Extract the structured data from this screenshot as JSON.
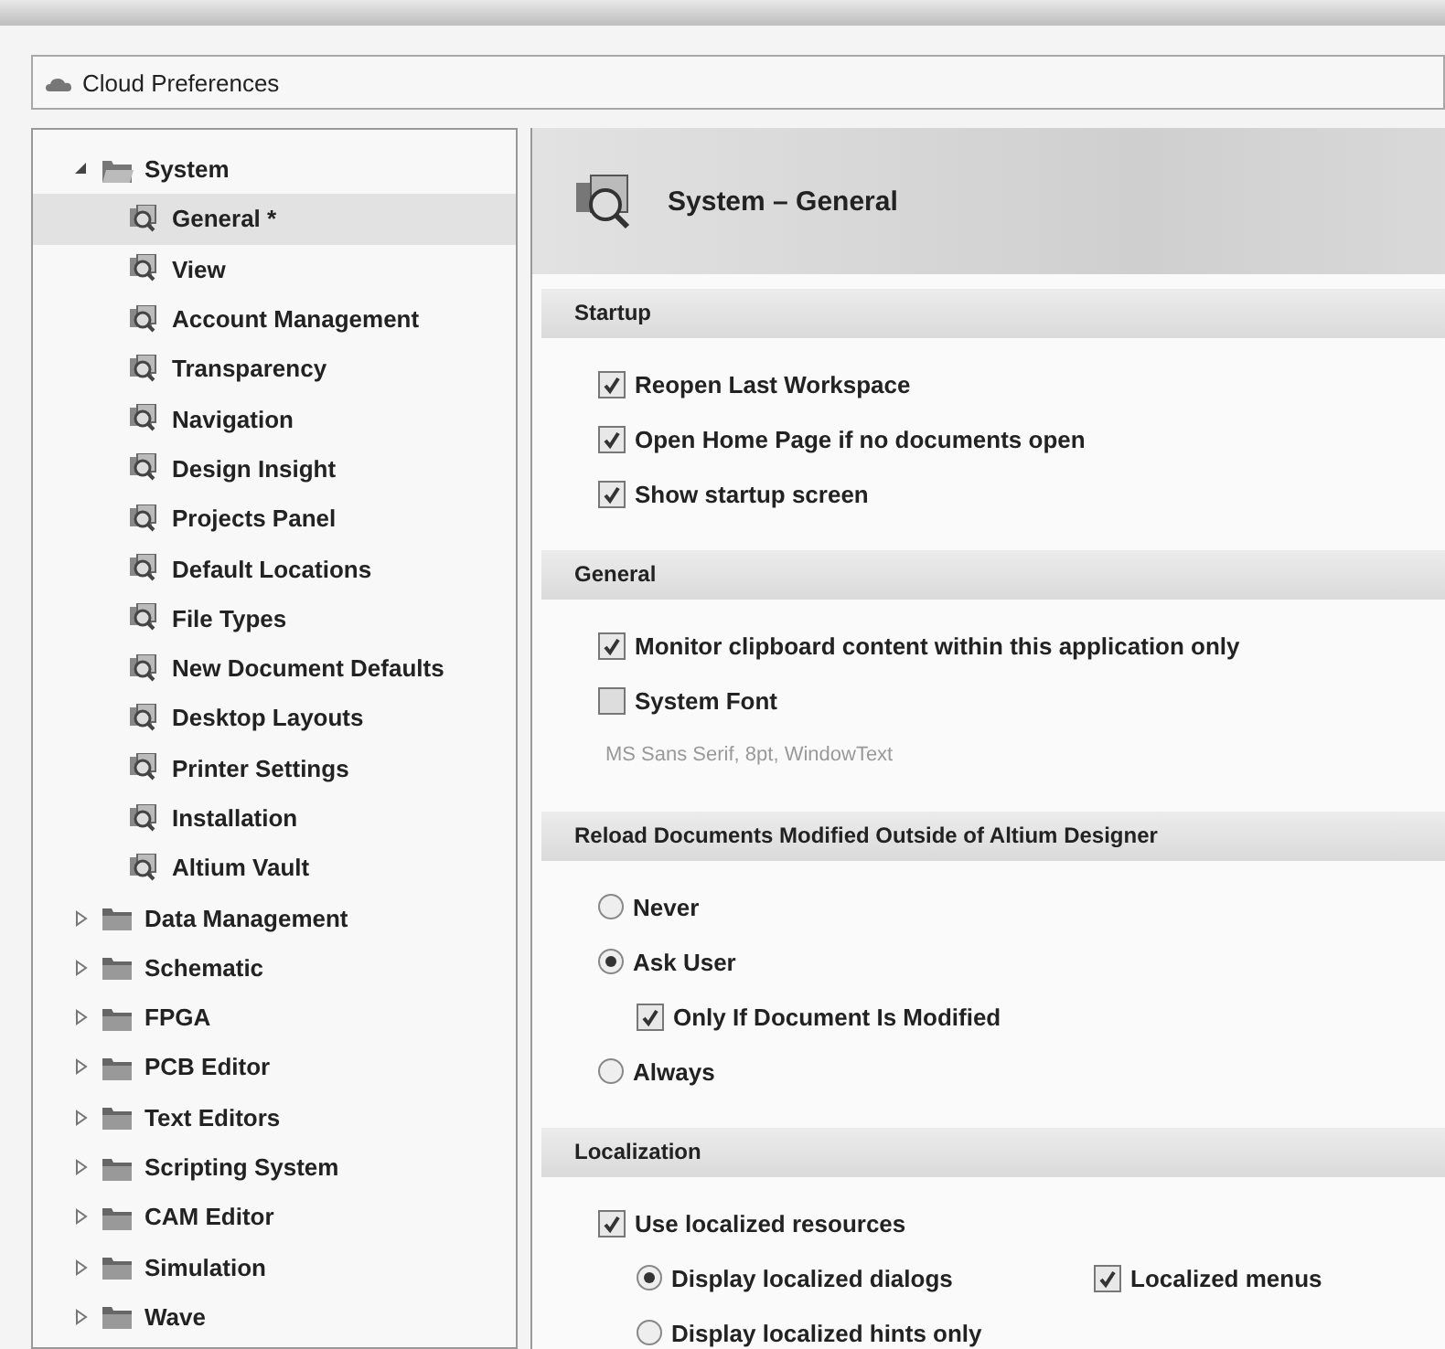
{
  "toolbar": {
    "label": "Cloud Preferences"
  },
  "tree": [
    {
      "label": "System",
      "expanded": true,
      "children": [
        {
          "label": "General *",
          "selected": true
        },
        {
          "label": "View",
          "selected": false
        },
        {
          "label": "Account Management",
          "selected": false
        },
        {
          "label": "Transparency",
          "selected": false
        },
        {
          "label": "Navigation",
          "selected": false
        },
        {
          "label": "Design Insight",
          "selected": false
        },
        {
          "label": "Projects Panel",
          "selected": false
        },
        {
          "label": "Default Locations",
          "selected": false
        },
        {
          "label": "File Types",
          "selected": false
        },
        {
          "label": "New Document Defaults",
          "selected": false
        },
        {
          "label": "Desktop Layouts",
          "selected": false
        },
        {
          "label": "Printer Settings",
          "selected": false
        },
        {
          "label": "Installation",
          "selected": false
        },
        {
          "label": "Altium Vault",
          "selected": false
        }
      ]
    },
    {
      "label": "Data Management",
      "expanded": false
    },
    {
      "label": "Schematic",
      "expanded": false
    },
    {
      "label": "FPGA",
      "expanded": false
    },
    {
      "label": "PCB Editor",
      "expanded": false
    },
    {
      "label": "Text Editors",
      "expanded": false
    },
    {
      "label": "Scripting System",
      "expanded": false
    },
    {
      "label": "CAM Editor",
      "expanded": false
    },
    {
      "label": "Simulation",
      "expanded": false
    },
    {
      "label": "Wave",
      "expanded": false
    }
  ],
  "page": {
    "title": "System – General",
    "sections": [
      {
        "title": "Startup",
        "items": [
          {
            "kind": "checkbox",
            "label": "Reopen Last Workspace",
            "checked": true
          },
          {
            "kind": "checkbox",
            "label": "Open Home Page if no documents open",
            "checked": true
          },
          {
            "kind": "checkbox",
            "label": "Show startup screen",
            "checked": true
          }
        ]
      },
      {
        "title": "General",
        "items": [
          {
            "kind": "checkbox",
            "label": "Monitor clipboard content within this application only",
            "checked": true
          },
          {
            "kind": "checkbox",
            "label": "System Font",
            "checked": false
          },
          {
            "kind": "note",
            "label": "MS Sans Serif, 8pt, WindowText"
          }
        ]
      },
      {
        "title": "Reload Documents Modified Outside of Altium Designer",
        "items": [
          {
            "kind": "radio",
            "label": "Never",
            "selected": false
          },
          {
            "kind": "radio",
            "label": "Ask User",
            "selected": true,
            "children": [
              {
                "kind": "checkbox",
                "label": "Only If Document Is Modified",
                "checked": true
              }
            ]
          },
          {
            "kind": "radio",
            "label": "Always",
            "selected": false
          }
        ]
      },
      {
        "title": "Localization",
        "items": [
          {
            "kind": "checkbox",
            "label": "Use localized resources",
            "checked": true,
            "children": [
              {
                "kind": "pair",
                "items": [
                  {
                    "kind": "radio",
                    "label": "Display localized dialogs",
                    "selected": true
                  },
                  {
                    "kind": "checkbox",
                    "label": "Localized menus",
                    "checked": true
                  }
                ]
              },
              {
                "kind": "radio",
                "label": "Display localized hints only",
                "selected": false
              }
            ]
          }
        ]
      }
    ]
  }
}
